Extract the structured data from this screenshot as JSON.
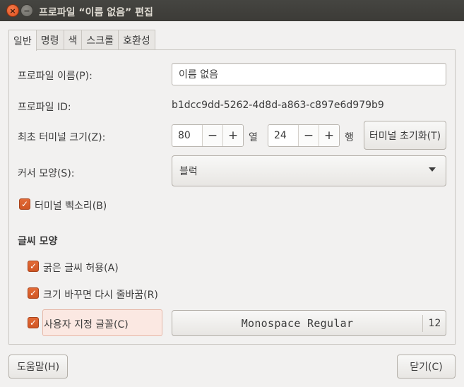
{
  "window": {
    "title": "프로파일 “이름 없음” 편집",
    "close_glyph": "×",
    "minimize_glyph": "−"
  },
  "tabs": [
    "일반",
    "명령",
    "색",
    "스크롤",
    "호환성"
  ],
  "general": {
    "profile_name_label": "프로파일 이름(P):",
    "profile_name_value": "이름 없음",
    "profile_id_label": "프로파일 ID:",
    "profile_id_value": "b1dcc9dd-5262-4d8d-a863-c897e6d979b9",
    "initial_size_label": "최초 터미널 크기(Z):",
    "columns_value": "80",
    "columns_unit": "열",
    "rows_value": "24",
    "rows_unit": "행",
    "minus_glyph": "−",
    "plus_glyph": "+",
    "reset_size_button": "터미널 초기화(T)",
    "cursor_shape_label": "커서 모양(S):",
    "cursor_shape_value": "블럭",
    "bell_label": "터미널 삑소리(B)",
    "text_appearance_heading": "글씨 모양",
    "allow_bold_label": "굵은 글씨 허용(A)",
    "rewrap_label": "크기 바꾸면 다시 줄바꿈(R)",
    "custom_font_label": "사용자 지정 글꼴(C)",
    "font_name": "Monospace Regular",
    "font_size": "12",
    "check_glyph": "✓"
  },
  "footer": {
    "help_button": "도움말(H)",
    "close_button": "닫기(C)"
  },
  "colors": {
    "accent": "#dd5a26",
    "titlebar": "#3c3b37"
  }
}
